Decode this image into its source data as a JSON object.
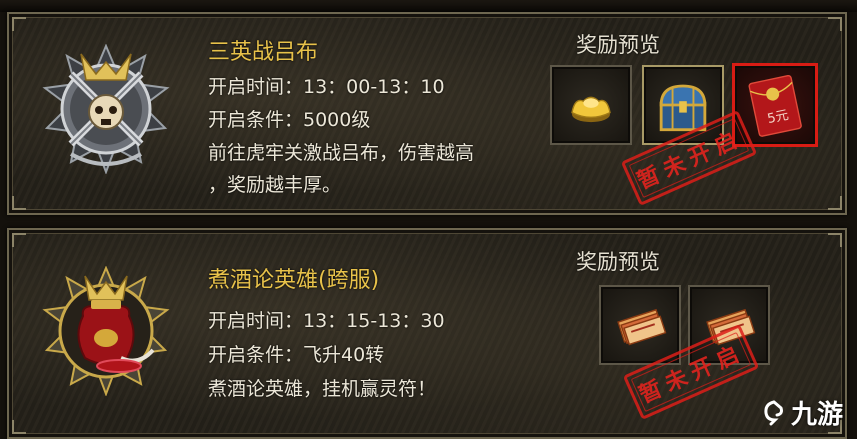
{
  "events": [
    {
      "title": "三英战吕布",
      "time_line": "开启时间：13：00-13：10",
      "condition_line": "开启条件：5000级",
      "description_line1": "前往虎牢关激战吕布，伤害越高",
      "description_line2": "，奖励越丰厚。",
      "reward_title": "奖励预览",
      "rewards": [
        {
          "icon": "gold-ingot-icon"
        },
        {
          "icon": "treasure-chest-icon"
        },
        {
          "icon": "red-envelope-icon",
          "label": "5元"
        }
      ],
      "stamp_text": "暂未开启"
    },
    {
      "title": "煮酒论英雄(跨服)",
      "time_line": "开启时间：13：15-13：30",
      "condition_line": "开启条件：飞升40转",
      "description_line1": "煮酒论英雄，挂机赢灵符！",
      "reward_title": "奖励预览",
      "rewards": [
        {
          "icon": "talisman-icon"
        },
        {
          "icon": "talisman-icon"
        }
      ],
      "stamp_text": "暂未开启"
    }
  ],
  "watermark": "九游",
  "colors": {
    "title": "#e8c24a",
    "text": "#ece7d8",
    "stamp": "#d81c14"
  }
}
